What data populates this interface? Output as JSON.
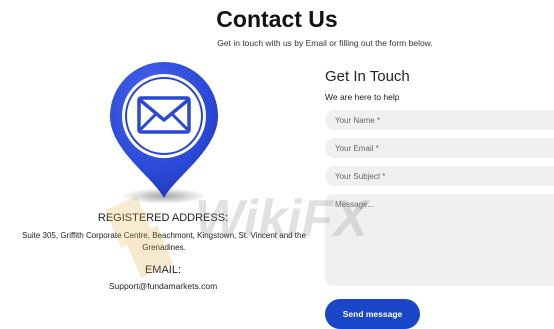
{
  "header": {
    "title": "Contact Us",
    "subtitle": "Get in touch with us by Email or filling out the form below."
  },
  "contact_info": {
    "pin_icon": "location-pin-mail-icon",
    "address_heading": "REGISTERED ADDRESS:",
    "address_text": "Suite 305, Griffith Corporate Centre, Beachmont, Kingstown, St. Vincent and the Grenadines.",
    "email_heading": "EMAIL:",
    "email_value": "Support@fundamarkets.com"
  },
  "form": {
    "title": "Get In Touch",
    "subtitle": "We are here to help",
    "name_placeholder": "Your Name *",
    "email_placeholder": "Your Email *",
    "subject_placeholder": "Your Subject *",
    "message_placeholder": "Message...",
    "submit_label": "Send message"
  },
  "watermark": {
    "text": "WikiFX"
  },
  "colors": {
    "accent": "#1a47c9",
    "pin_blue": "#2a48d6",
    "field_bg": "#f0f0f0"
  }
}
